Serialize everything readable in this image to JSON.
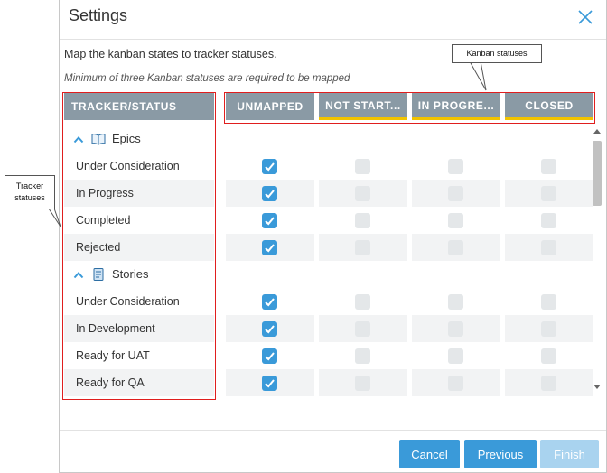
{
  "dialog": {
    "title": "Settings",
    "intro": "Map the kanban states to tracker statuses.",
    "note": "Minimum of three Kanban statuses are required to be mapped"
  },
  "table": {
    "headers": {
      "tracker": "TRACKER/STATUS",
      "unmapped": "UNMAPPED",
      "kanban": [
        "NOT START...",
        "IN PROGRE...",
        "CLOSED"
      ]
    },
    "groups": [
      {
        "name": "Epics",
        "icon": "book-icon",
        "rows": [
          {
            "label": "Under Consideration",
            "unmapped": true,
            "k1": false,
            "k2": false,
            "k3": false
          },
          {
            "label": "In Progress",
            "unmapped": true,
            "k1": false,
            "k2": false,
            "k3": false
          },
          {
            "label": "Completed",
            "unmapped": true,
            "k1": false,
            "k2": false,
            "k3": false
          },
          {
            "label": "Rejected",
            "unmapped": true,
            "k1": false,
            "k2": false,
            "k3": false
          }
        ]
      },
      {
        "name": "Stories",
        "icon": "story-icon",
        "rows": [
          {
            "label": "Under Consideration",
            "unmapped": true,
            "k1": false,
            "k2": false,
            "k3": false
          },
          {
            "label": "In Development",
            "unmapped": true,
            "k1": false,
            "k2": false,
            "k3": false
          },
          {
            "label": "Ready for UAT",
            "unmapped": true,
            "k1": false,
            "k2": false,
            "k3": false
          },
          {
            "label": "Ready for QA",
            "unmapped": true,
            "k1": false,
            "k2": false,
            "k3": false
          }
        ]
      }
    ]
  },
  "footer": {
    "cancel": "Cancel",
    "previous": "Previous",
    "finish": "Finish"
  },
  "annotations": {
    "kanban": "Kanban statuses",
    "tracker_line1": "Tracker",
    "tracker_line2": "statuses"
  },
  "colors": {
    "header_bg": "#8a9aa5",
    "accent": "#3a9ad9",
    "kanban_underline": "#f2c400",
    "annotation_red": "#e01e1e"
  }
}
